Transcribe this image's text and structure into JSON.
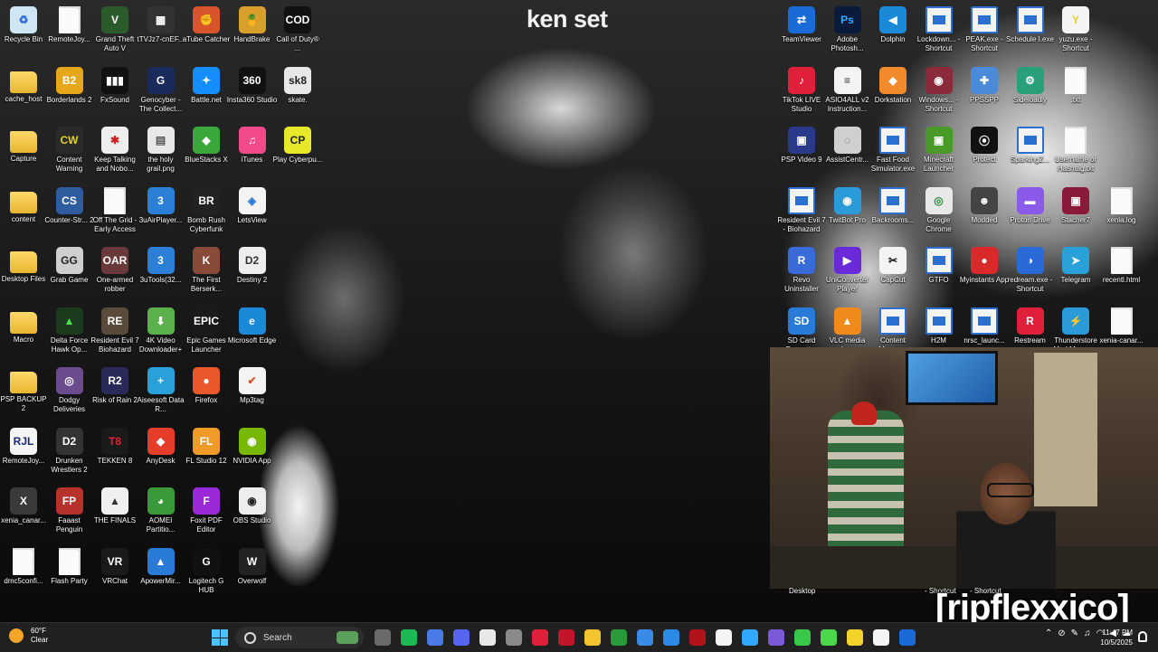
{
  "wallpaper": {
    "title": "ken set"
  },
  "stream_brand": "[ripflexxico]",
  "desktop_icons": [
    {
      "label": "Recycle Bin",
      "kind": "bin",
      "col": 0,
      "row": 0
    },
    {
      "label": "cache_host",
      "kind": "folder",
      "col": 0,
      "row": 1
    },
    {
      "label": "Capture",
      "kind": "folder",
      "col": 0,
      "row": 2
    },
    {
      "label": "content",
      "kind": "folder",
      "col": 0,
      "row": 3
    },
    {
      "label": "Desktop Files",
      "kind": "folder",
      "col": 0,
      "row": 4
    },
    {
      "label": "Macro",
      "kind": "folder",
      "col": 0,
      "row": 5
    },
    {
      "label": "PSP BACKUP 2",
      "kind": "folder",
      "col": 0,
      "row": 6
    },
    {
      "label": "RemoteJoy...",
      "kind": "app",
      "color": "#f5f5f5",
      "text": "RJL",
      "fg": "#1a2a6a",
      "col": 0,
      "row": 7
    },
    {
      "label": "xenia_canar...",
      "kind": "app",
      "color": "#3a3a3a",
      "text": "X",
      "col": 0,
      "row": 8
    },
    {
      "label": "dmc5confi...",
      "kind": "file",
      "col": 0,
      "row": 9
    },
    {
      "label": "RemoteJoy...",
      "kind": "file",
      "col": 1,
      "row": 0
    },
    {
      "label": "Borderlands 2",
      "kind": "app",
      "color": "#e6a81a",
      "text": "B2",
      "col": 1,
      "row": 1
    },
    {
      "label": "Content Warning",
      "kind": "app",
      "color": "#2a2a2a",
      "text": "CW",
      "fg": "#e6d21a",
      "col": 1,
      "row": 2
    },
    {
      "label": "Counter-Str... 2",
      "kind": "app",
      "color": "#2d5d9e",
      "text": "CS",
      "col": 1,
      "row": 3
    },
    {
      "label": "Grab Game",
      "kind": "app",
      "color": "#cfcfcf",
      "text": "GG",
      "fg": "#222",
      "col": 1,
      "row": 4
    },
    {
      "label": "Delta Force Hawk Op...",
      "kind": "app",
      "color": "#1c3a1c",
      "text": "▲",
      "fg": "#4fe04f",
      "col": 1,
      "row": 5
    },
    {
      "label": "Dodgy Deliveries",
      "kind": "app",
      "color": "#6b4a8e",
      "text": "◎",
      "col": 1,
      "row": 6
    },
    {
      "label": "Drunken Wrestlers 2",
      "kind": "app",
      "color": "#333",
      "text": "D2",
      "col": 1,
      "row": 7
    },
    {
      "label": "Faaast Penguin",
      "kind": "app",
      "color": "#b8322c",
      "text": "FP",
      "col": 1,
      "row": 8
    },
    {
      "label": "Flash Party",
      "kind": "file",
      "col": 1,
      "row": 9
    },
    {
      "label": "Grand Theft Auto V",
      "kind": "app",
      "color": "#2b5a2b",
      "text": "V",
      "col": 2,
      "row": 0
    },
    {
      "label": "FxSound",
      "kind": "app",
      "color": "#111",
      "text": "▮▮▮",
      "col": 2,
      "row": 1
    },
    {
      "label": "Keep Talking and Nobo...",
      "kind": "app",
      "color": "#eee",
      "text": "✱",
      "fg": "#c22",
      "col": 2,
      "row": 2
    },
    {
      "label": "Off The Grid - Early Access",
      "kind": "file",
      "col": 2,
      "row": 3
    },
    {
      "label": "One-armed robber",
      "kind": "app",
      "color": "#6a3a3a",
      "text": "OAR",
      "col": 2,
      "row": 4
    },
    {
      "label": "Resident Evil 7 Biohazard",
      "kind": "app",
      "color": "#5a4a3a",
      "text": "RE",
      "col": 2,
      "row": 5
    },
    {
      "label": "Risk of Rain 2",
      "kind": "app",
      "color": "#2a2a5a",
      "text": "R2",
      "col": 2,
      "row": 6
    },
    {
      "label": "TEKKEN 8",
      "kind": "app",
      "color": "#1a1a1a",
      "text": "T8",
      "fg": "#e0213a",
      "col": 2,
      "row": 7
    },
    {
      "label": "THE FINALS",
      "kind": "app",
      "color": "#f0f0f0",
      "text": "▲",
      "fg": "#333",
      "col": 2,
      "row": 8
    },
    {
      "label": "VRChat",
      "kind": "app",
      "color": "#1a1a1a",
      "text": "VR",
      "col": 2,
      "row": 9
    },
    {
      "label": "tTVJz7-cnEF...",
      "kind": "app",
      "color": "#333",
      "text": "▦",
      "col": 3,
      "row": 0
    },
    {
      "label": "Genocyber - The Collect...",
      "kind": "app",
      "color": "#1a2a5a",
      "text": "G",
      "col": 3,
      "row": 1
    },
    {
      "label": "the holy grail.png",
      "kind": "app",
      "color": "#e8e8e8",
      "text": "▤",
      "fg": "#555",
      "col": 3,
      "row": 2
    },
    {
      "label": "3uAirPlayer...",
      "kind": "app",
      "color": "#2b7fd6",
      "text": "3",
      "col": 3,
      "row": 3
    },
    {
      "label": "3uTools(32...",
      "kind": "app",
      "color": "#2b7fd6",
      "text": "3",
      "col": 3,
      "row": 4
    },
    {
      "label": "4K Video Downloader+",
      "kind": "app",
      "color": "#5ab04a",
      "text": "⬇",
      "col": 3,
      "row": 5
    },
    {
      "label": "Aiseesoft Data R...",
      "kind": "app",
      "color": "#2aa0d8",
      "text": "+",
      "col": 3,
      "row": 6
    },
    {
      "label": "AnyDesk",
      "kind": "app",
      "color": "#e63c2a",
      "text": "◆",
      "col": 3,
      "row": 7
    },
    {
      "label": "AOMEI Partitio...",
      "kind": "app",
      "color": "#3a9a3a",
      "text": "◕",
      "col": 3,
      "row": 8
    },
    {
      "label": "ApowerMir...",
      "kind": "app",
      "color": "#2a7ad8",
      "text": "▲",
      "col": 3,
      "row": 9
    },
    {
      "label": "aTube Catcher",
      "kind": "app",
      "color": "#d8542a",
      "text": "✊",
      "col": 4,
      "row": 0
    },
    {
      "label": "Battle.net",
      "kind": "app",
      "color": "#148eff",
      "text": "✦",
      "col": 4,
      "row": 1
    },
    {
      "label": "BlueStacks X",
      "kind": "app",
      "color": "#3aa83a",
      "text": "◆",
      "col": 4,
      "row": 2
    },
    {
      "label": "Bomb Rush Cyberfunk",
      "kind": "app",
      "color": "#222",
      "text": "BR",
      "col": 4,
      "row": 3
    },
    {
      "label": "The First Berserk...",
      "kind": "app",
      "color": "#8a4a3a",
      "text": "K",
      "col": 4,
      "row": 4
    },
    {
      "label": "Epic Games Launcher",
      "kind": "app",
      "color": "#1a1a1a",
      "text": "EPIC",
      "col": 4,
      "row": 5
    },
    {
      "label": "Firefox",
      "kind": "app",
      "color": "#e8582a",
      "text": "●",
      "col": 4,
      "row": 6
    },
    {
      "label": "FL Studio 12",
      "kind": "app",
      "color": "#f09a2a",
      "text": "FL",
      "col": 4,
      "row": 7
    },
    {
      "label": "Foxit PDF Editor",
      "kind": "app",
      "color": "#9a2ad8",
      "text": "F",
      "col": 4,
      "row": 8
    },
    {
      "label": "Logitech G HUB",
      "kind": "app",
      "color": "#111",
      "text": "G",
      "col": 4,
      "row": 9
    },
    {
      "label": "HandBrake",
      "kind": "app",
      "color": "#d8a02a",
      "text": "🍍",
      "col": 5,
      "row": 0
    },
    {
      "label": "Insta360 Studio",
      "kind": "app",
      "color": "#111",
      "text": "360",
      "col": 5,
      "row": 1
    },
    {
      "label": "iTunes",
      "kind": "app",
      "color": "#f04a8a",
      "text": "♫",
      "col": 5,
      "row": 2
    },
    {
      "label": "LetsView",
      "kind": "app",
      "color": "#f4f4f4",
      "text": "◈",
      "fg": "#2a7ad8",
      "col": 5,
      "row": 3
    },
    {
      "label": "Destiny 2",
      "kind": "app",
      "color": "#eee",
      "text": "D2",
      "fg": "#333",
      "col": 5,
      "row": 4
    },
    {
      "label": "Microsoft Edge",
      "kind": "app",
      "color": "#1a8ad8",
      "text": "e",
      "col": 5,
      "row": 5
    },
    {
      "label": "Mp3tag",
      "kind": "app",
      "color": "#f4f4f4",
      "text": "✔",
      "fg": "#d8542a",
      "col": 5,
      "row": 6
    },
    {
      "label": "NVIDIA App",
      "kind": "app",
      "color": "#76b900",
      "text": "◉",
      "col": 5,
      "row": 7
    },
    {
      "label": "OBS Studio",
      "kind": "app",
      "color": "#eee",
      "text": "◉",
      "fg": "#222",
      "col": 5,
      "row": 8
    },
    {
      "label": "Overwolf",
      "kind": "app",
      "color": "#222",
      "text": "W",
      "col": 5,
      "row": 9
    },
    {
      "label": "Call of Duty® ...",
      "kind": "app",
      "color": "#111",
      "text": "COD",
      "col": 6,
      "row": 0
    },
    {
      "label": "skate.",
      "kind": "app",
      "color": "#e8e8e8",
      "text": "sk8",
      "fg": "#222",
      "col": 6,
      "row": 1
    },
    {
      "label": "Play Cyberpu...",
      "kind": "app",
      "color": "#e8e82a",
      "text": "CP",
      "fg": "#222",
      "col": 6,
      "row": 2
    }
  ],
  "desktop_icons_right": [
    {
      "label": "TeamViewer",
      "kind": "app",
      "color": "#1a6ad8",
      "text": "⇄",
      "col": 0,
      "row": 0
    },
    {
      "label": "Adobe Photosh...",
      "kind": "app",
      "color": "#0a1a3a",
      "text": "Ps",
      "fg": "#31a8ff",
      "col": 1,
      "row": 0
    },
    {
      "label": "Dolphin",
      "kind": "app",
      "color": "#1a8ad8",
      "text": "◀",
      "col": 2,
      "row": 0
    },
    {
      "label": "Lockdown... - Shortcut",
      "kind": "short",
      "col": 3,
      "row": 0
    },
    {
      "label": "PEAK.exe - Shortcut",
      "kind": "short",
      "col": 4,
      "row": 0
    },
    {
      "label": "Schedule I.exe",
      "kind": "short",
      "col": 5,
      "row": 0
    },
    {
      "label": "yuzu.exe - Shortcut",
      "kind": "app",
      "color": "#f4f4f4",
      "text": "Y",
      "fg": "#e8c82a",
      "col": 6,
      "row": 0
    },
    {
      "label": "TikTok LIVE Studio",
      "kind": "app",
      "color": "#e0203a",
      "text": "♪",
      "col": 0,
      "row": 1
    },
    {
      "label": "ASIO4ALL v2 Instruction...",
      "kind": "app",
      "color": "#f4f4f4",
      "text": "≡",
      "fg": "#333",
      "col": 1,
      "row": 1
    },
    {
      "label": "Dorkstation",
      "kind": "app",
      "color": "#f08a2a",
      "text": "◆",
      "col": 2,
      "row": 1
    },
    {
      "label": "Windows... - Shortcut",
      "kind": "app",
      "color": "#8a2a3a",
      "text": "◉",
      "col": 3,
      "row": 1
    },
    {
      "label": "PPSSPP",
      "kind": "app",
      "color": "#4a8ad8",
      "text": "✚",
      "col": 4,
      "row": 1
    },
    {
      "label": "Sideloadly",
      "kind": "app",
      "color": "#2aa07a",
      "text": "⚙",
      "col": 5,
      "row": 1
    },
    {
      "label": ".txt",
      "kind": "file",
      "col": 6,
      "row": 1
    },
    {
      "label": "PSP Video 9",
      "kind": "app",
      "color": "#2a3a8a",
      "text": "▣",
      "col": 0,
      "row": 2
    },
    {
      "label": "AssistCentr...",
      "kind": "app",
      "color": "#cfcfcf",
      "text": "◌",
      "fg": "#555",
      "col": 1,
      "row": 2
    },
    {
      "label": "Fast Food Simulator.exe",
      "kind": "short",
      "col": 2,
      "row": 2
    },
    {
      "label": "Minecraft Launcher",
      "kind": "app",
      "color": "#4a9a2a",
      "text": "▣",
      "col": 3,
      "row": 2
    },
    {
      "label": "Protect",
      "kind": "app",
      "color": "#111",
      "text": "⦿",
      "col": 4,
      "row": 2
    },
    {
      "label": "SparkingZ...",
      "kind": "short",
      "col": 5,
      "row": 2
    },
    {
      "label": "Username or Hashtag.txt",
      "kind": "file",
      "col": 6,
      "row": 2
    },
    {
      "label": "Resident Evil 7 - Biohazard",
      "kind": "short",
      "col": 0,
      "row": 3
    },
    {
      "label": "TwitBot Pro",
      "kind": "app",
      "color": "#2a9ad8",
      "text": "◉",
      "col": 1,
      "row": 3
    },
    {
      "label": "Backrooms...",
      "kind": "short",
      "col": 2,
      "row": 3
    },
    {
      "label": "Google Chrome",
      "kind": "app",
      "color": "#e8e8e8",
      "text": "◎",
      "fg": "#2a8a3a",
      "col": 3,
      "row": 3
    },
    {
      "label": "Modded",
      "kind": "app",
      "color": "#444",
      "text": "☻",
      "col": 4,
      "row": 3
    },
    {
      "label": "Proton Drive",
      "kind": "app",
      "color": "#8a5ae8",
      "text": "▬",
      "col": 5,
      "row": 3
    },
    {
      "label": "Stacher7",
      "kind": "app",
      "color": "#8a1a3a",
      "text": "▣",
      "col": 6,
      "row": 3
    },
    {
      "label": "xenia.log",
      "kind": "file",
      "col": 7,
      "row": 3
    },
    {
      "label": "Revo Uninstaller",
      "kind": "app",
      "color": "#3a6ad8",
      "text": "R",
      "col": 0,
      "row": 4
    },
    {
      "label": "UniConverter Player",
      "kind": "app",
      "color": "#6a2ad8",
      "text": "▶",
      "col": 1,
      "row": 4
    },
    {
      "label": "CapCut",
      "kind": "app",
      "color": "#f4f4f4",
      "text": "✂",
      "fg": "#111",
      "col": 2,
      "row": 4
    },
    {
      "label": "GTFO",
      "kind": "short",
      "col": 3,
      "row": 4
    },
    {
      "label": "Myinstants App",
      "kind": "app",
      "color": "#d82a2a",
      "text": "●",
      "col": 4,
      "row": 4
    },
    {
      "label": "redream.exe - Shortcut",
      "kind": "app",
      "color": "#2a6ad8",
      "text": "◑",
      "col": 5,
      "row": 4
    },
    {
      "label": "Telegram",
      "kind": "app",
      "color": "#2aa0d8",
      "text": "➤",
      "col": 6,
      "row": 4
    },
    {
      "label": "recentl.html",
      "kind": "file",
      "col": 7,
      "row": 4
    },
    {
      "label": "SD Card Formatter",
      "kind": "app",
      "color": "#2a7ad8",
      "text": "SD",
      "col": 0,
      "row": 5
    },
    {
      "label": "VLC media player",
      "kind": "app",
      "color": "#f08a1a",
      "text": "▲",
      "col": 1,
      "row": 5
    },
    {
      "label": "Content Manager",
      "kind": "short",
      "col": 2,
      "row": 5
    },
    {
      "label": "H2M",
      "kind": "short",
      "col": 3,
      "row": 5
    },
    {
      "label": "nrsc_launc...",
      "kind": "short",
      "col": 4,
      "row": 5
    },
    {
      "label": "Restream",
      "kind": "app",
      "color": "#e0203a",
      "text": "R",
      "col": 5,
      "row": 5
    },
    {
      "label": "Thunderstore Mod Manager",
      "kind": "app",
      "color": "#2a9ad8",
      "text": "⚡",
      "col": 6,
      "row": 5
    },
    {
      "label": "xenia-canar...",
      "kind": "file",
      "col": 7,
      "row": 5
    }
  ],
  "overlay_labels": {
    "desktop": "Desktop",
    "shortcut_a": "- Shortcut",
    "shortcut_b": "- Shortcut"
  },
  "taskbar": {
    "weather_temp": "60°F",
    "weather_desc": "Clear",
    "search_placeholder": "Search",
    "apps": [
      {
        "name": "task-view",
        "color": "#6a6a6a"
      },
      {
        "name": "spotify",
        "color": "#1db954"
      },
      {
        "name": "copilot",
        "color": "#4a7ae8"
      },
      {
        "name": "discord",
        "color": "#5865f2"
      },
      {
        "name": "roblox",
        "color": "#e8e8e8"
      },
      {
        "name": "spotify-2",
        "color": "#8a8a8a"
      },
      {
        "name": "tiktok",
        "color": "#e0203a"
      },
      {
        "name": "opera",
        "color": "#c2142a"
      },
      {
        "name": "file-explorer",
        "color": "#f4c430"
      },
      {
        "name": "xbox",
        "color": "#2a9a3a"
      },
      {
        "name": "chrome",
        "color": "#3a8ae8"
      },
      {
        "name": "photos",
        "color": "#2a8ae8"
      },
      {
        "name": "record",
        "color": "#b0141a"
      },
      {
        "name": "capcut",
        "color": "#f4f4f4"
      },
      {
        "name": "photoshop",
        "color": "#31a8ff"
      },
      {
        "name": "obs",
        "color": "#7a5ad8"
      },
      {
        "name": "line",
        "color": "#3ac84a"
      },
      {
        "name": "app-green",
        "color": "#4ad84a"
      },
      {
        "name": "notes",
        "color": "#f4d42a"
      },
      {
        "name": "capcut-2",
        "color": "#f4f4f4"
      },
      {
        "name": "teamviewer",
        "color": "#1a6ad8"
      }
    ],
    "time": "11:47 PM",
    "date": "10/5/2025"
  }
}
